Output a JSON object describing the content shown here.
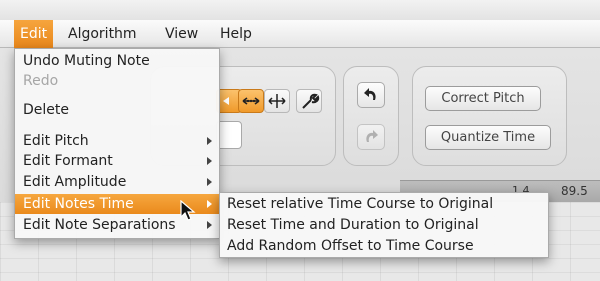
{
  "menubar": {
    "items": [
      {
        "label": "Edit",
        "active": true
      },
      {
        "label": "Algorithm"
      },
      {
        "label": "View"
      },
      {
        "label": "Help"
      }
    ]
  },
  "edit_menu": {
    "items": [
      {
        "label": "Undo Muting Note",
        "enabled": true
      },
      {
        "label": "Redo",
        "enabled": false
      },
      {
        "label": "Delete",
        "enabled": true
      },
      {
        "label": "Edit Pitch",
        "submenu": true
      },
      {
        "label": "Edit Formant",
        "submenu": true
      },
      {
        "label": "Edit Amplitude",
        "submenu": true
      },
      {
        "label": "Edit Notes Time",
        "submenu": true,
        "highlighted": true
      },
      {
        "label": "Edit Note Separations",
        "submenu": true
      }
    ]
  },
  "submenu": {
    "items": [
      {
        "label": "Reset relative Time Course to Original"
      },
      {
        "label": "Reset Time and Duration to Original"
      },
      {
        "label": "Add Random Offset to Time Course"
      }
    ]
  },
  "toolbar": {
    "correct_pitch_label": "Correct Pitch",
    "quantize_time_label": "Quantize Time",
    "undo_icon": "undo-arrow-icon",
    "redo_icon": "redo-arrow-icon"
  },
  "ruler": {
    "marks": "1  4",
    "value": "89.5"
  },
  "colors": {
    "highlight": "#ea8a1c",
    "menu_bg": "#f7f7f7"
  }
}
